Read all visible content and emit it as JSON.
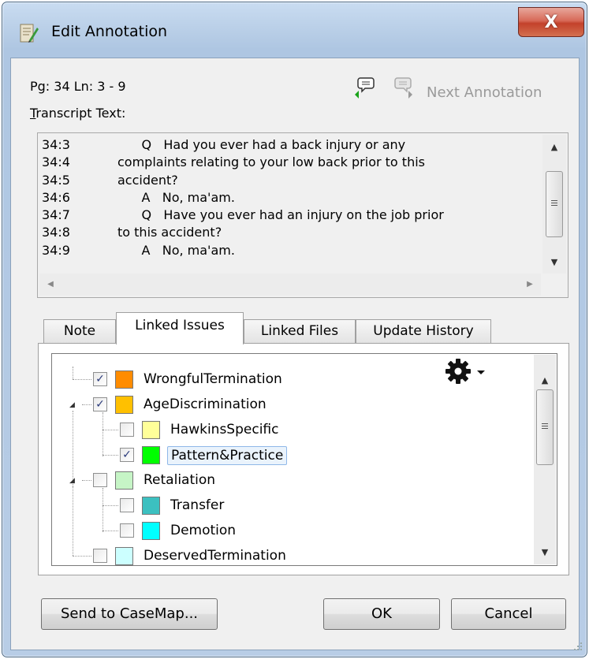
{
  "window": {
    "title": "Edit Annotation",
    "close_label": "X"
  },
  "header": {
    "page_line": "Pg: 34 Ln: 3 - 9",
    "transcript_label_u": "T",
    "transcript_label_rest": "ranscript Text:",
    "next_annotation": "Next Annotation"
  },
  "transcript": {
    "lines": [
      {
        "num": "34:3",
        "text": "      Q   Had you ever had a back injury or any"
      },
      {
        "num": "34:4",
        "text": "complaints relating to your low back prior to this"
      },
      {
        "num": "34:5",
        "text": "accident?"
      },
      {
        "num": "34:6",
        "text": "      A   No, ma'am."
      },
      {
        "num": "34:7",
        "text": "      Q   Have you ever had an injury on the job prior"
      },
      {
        "num": "34:8",
        "text": "to this accident?"
      },
      {
        "num": "34:9",
        "text": "      A   No, ma'am."
      }
    ]
  },
  "tabs": [
    {
      "label": "Note",
      "active": false
    },
    {
      "label": "Linked Issues",
      "active": true
    },
    {
      "label": "Linked Files",
      "active": false
    },
    {
      "label": "Update History",
      "active": false
    }
  ],
  "issues": [
    {
      "name": "WrongfulTermination",
      "checked": true,
      "color": "#ff8c00"
    },
    {
      "name": "AgeDiscrimination",
      "checked": true,
      "color": "#ffc000"
    },
    {
      "name": "HawkinsSpecific",
      "checked": false,
      "color": "#ffff99"
    },
    {
      "name": "Pattern&Practice",
      "checked": true,
      "color": "#00ff00",
      "selected": true
    },
    {
      "name": "Retaliation",
      "checked": false,
      "color": "#c6f5c6"
    },
    {
      "name": "Transfer",
      "checked": false,
      "color": "#3cc0c0"
    },
    {
      "name": "Demotion",
      "checked": false,
      "color": "#00ffff"
    },
    {
      "name": "DeservedTermination",
      "checked": false,
      "color": "#ccffff"
    }
  ],
  "buttons": {
    "send_to_casemap": "Send to CaseMap...",
    "ok": "OK",
    "cancel": "Cancel"
  },
  "icons": {
    "app": "annotation-app-icon",
    "prev_annotation": "previous-annotation-icon",
    "next_annotation": "next-annotation-icon",
    "gear": "gear-icon"
  }
}
